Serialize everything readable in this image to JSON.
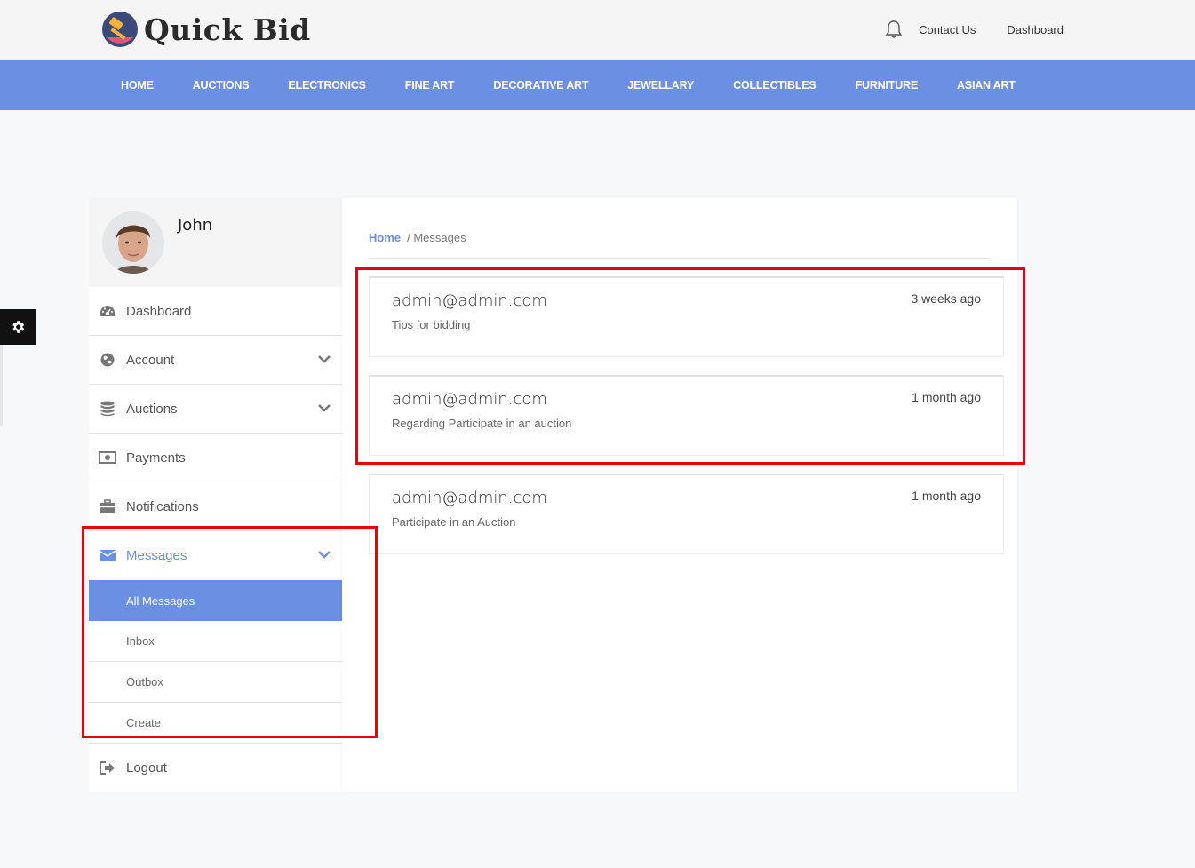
{
  "header": {
    "logo_text": "Quick Bid",
    "links": [
      "Contact Us",
      "Dashboard"
    ]
  },
  "nav": {
    "items": [
      "HOME",
      "AUCTIONS",
      "ELECTRONICS",
      "FINE ART",
      "DECORATIVE ART",
      "JEWELLARY",
      "COLLECTIBLES",
      "FURNITURE",
      "ASIAN ART"
    ]
  },
  "profile": {
    "name": "John"
  },
  "sidebar": {
    "items": [
      {
        "label": "Dashboard",
        "icon": "dashboard-icon"
      },
      {
        "label": "Account",
        "icon": "globe-icon"
      },
      {
        "label": "Auctions",
        "icon": "database-icon"
      },
      {
        "label": "Payments",
        "icon": "money-icon"
      },
      {
        "label": "Notifications",
        "icon": "briefcase-icon"
      },
      {
        "label": "Messages",
        "icon": "envelope-icon"
      }
    ],
    "messages_sub": [
      "All Messages",
      "Inbox",
      "Outbox",
      "Create"
    ],
    "logout_label": "Logout"
  },
  "breadcrumb": {
    "home": "Home",
    "current": "/ Messages"
  },
  "messages": [
    {
      "from": "admin@admin.com",
      "subject": "Tips for bidding",
      "time": "3 weeks ago"
    },
    {
      "from": "admin@admin.com",
      "subject": "Regarding Participate in an auction",
      "time": "1 month ago"
    },
    {
      "from": "admin@admin.com",
      "subject": "Participate in an Auction",
      "time": "1 month ago"
    }
  ],
  "colors": {
    "accent": "#6a8fe3",
    "highlight": "#e8060e"
  }
}
